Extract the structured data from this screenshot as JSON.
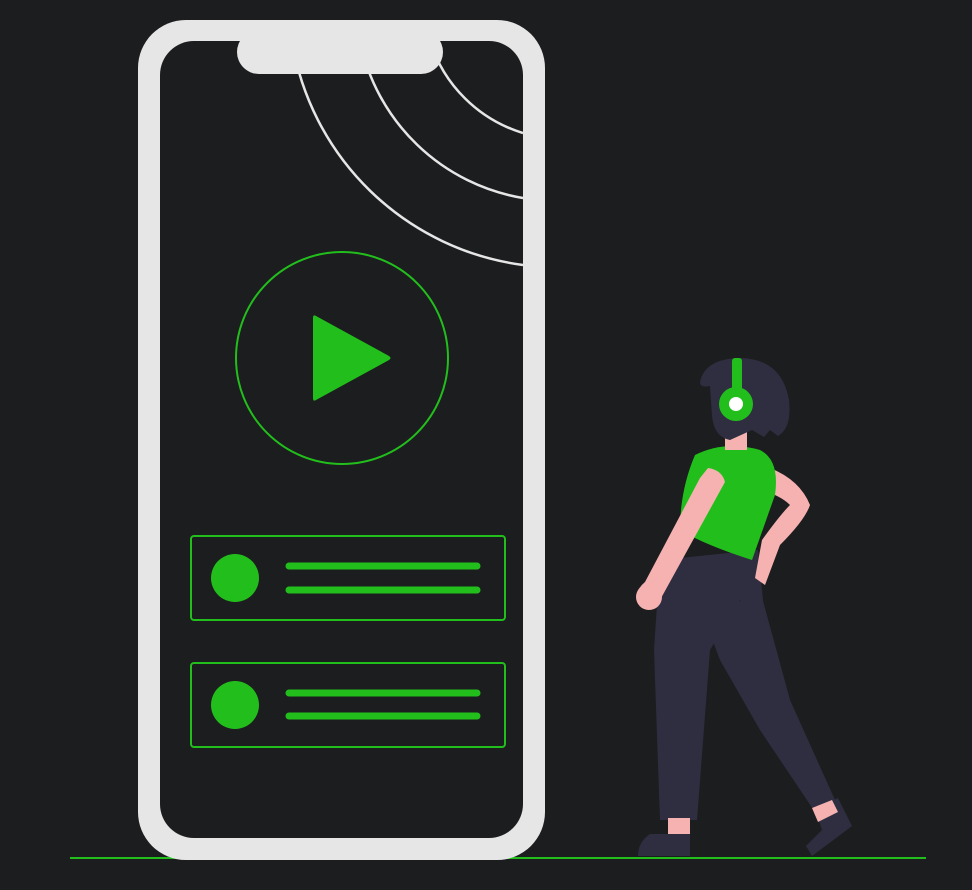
{
  "colors": {
    "background": "#1c1d1f",
    "phone_frame": "#e6e6e6",
    "screen": "#1c1d1f",
    "accent_green": "#22bf1c",
    "wave_lines": "#e6e6e6",
    "skin": "#f5b2b0",
    "hair": "#2f2e41",
    "pants": "#2f2e41",
    "shoes": "#2f2e41",
    "headphone_dot": "#ffffff"
  },
  "icons": {
    "play": "play-icon",
    "signal": "signal-waves-icon",
    "headphones": "headphones-icon"
  },
  "playlist": {
    "items": [
      {
        "id": "track-1"
      },
      {
        "id": "track-2"
      }
    ]
  }
}
